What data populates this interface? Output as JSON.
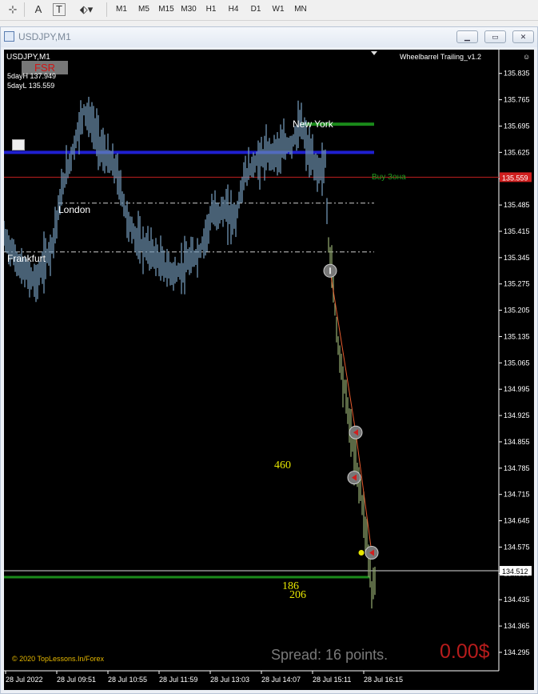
{
  "toolbar": {
    "tools": [
      {
        "name": "crosshair-icon",
        "glyph": "⊹"
      },
      {
        "name": "text-tool-icon",
        "glyph": "A"
      },
      {
        "name": "text-label-icon",
        "glyph": "T"
      },
      {
        "name": "objects-menu-icon",
        "glyph": "⬖▾"
      }
    ],
    "timeframes": [
      "M1",
      "M5",
      "M15",
      "M30",
      "H1",
      "H4",
      "D1",
      "W1",
      "MN"
    ]
  },
  "window": {
    "title": "USDJPY,M1",
    "buttons": [
      "minimize",
      "restore",
      "close"
    ]
  },
  "chart": {
    "symbol_label": "USDJPY,M1",
    "indicator_name": "Wheelbarrel Trailing_v1.2",
    "fsr_label": "FSR",
    "day_high": "5dayH 137.949",
    "day_low": "5dayL 135.559",
    "sessions": [
      "New York",
      "London",
      "Frankfurt"
    ],
    "buy_zone": "Buy Зона",
    "count_a": "460",
    "count_b": "186",
    "count_c": "206",
    "copyright": "© 2020 TopLessons.In/Forex",
    "spread": "Spread: 16 points.",
    "profit": "0.00$",
    "current_price": "134.512",
    "red_line_price": "135.559",
    "colors": {
      "background": "#000000",
      "bars": "#6f95b3",
      "support": "#1f1fd0",
      "resistance": "#c01f1f",
      "green_level": "#1a8a1a",
      "yellow_text": "#e6e600",
      "grey_text": "#7a7a7a",
      "profit_text": "#b71c1c"
    }
  },
  "chart_data": {
    "type": "candlestick",
    "y_ticks": [
      "135.835",
      "135.765",
      "135.695",
      "135.625",
      "135.555",
      "135.485",
      "135.415",
      "135.345",
      "135.275",
      "135.205",
      "135.135",
      "135.065",
      "134.995",
      "134.925",
      "134.855",
      "134.785",
      "134.715",
      "134.645",
      "134.575",
      "134.505",
      "134.435",
      "134.365",
      "134.295"
    ],
    "x_ticks": [
      "28 Jul 2022",
      "28 Jul 09:51",
      "28 Jul 10:55",
      "28 Jul 11:59",
      "28 Jul 13:03",
      "28 Jul 14:07",
      "28 Jul 15:11",
      "28 Jul 16:15"
    ],
    "ylim": [
      134.28,
      135.86
    ],
    "levels": {
      "blue_support": 135.625,
      "red_line": 135.559,
      "london_dash": 135.49,
      "frankfurt_dash": 135.36,
      "new_york_green": 135.7,
      "bottom_green": 134.495,
      "current": 134.512
    },
    "close_path": [
      [
        0,
        135.4
      ],
      [
        20,
        135.32
      ],
      [
        40,
        135.28
      ],
      [
        60,
        135.38
      ],
      [
        75,
        135.55
      ],
      [
        90,
        135.66
      ],
      [
        100,
        135.74
      ],
      [
        110,
        135.7
      ],
      [
        125,
        135.62
      ],
      [
        140,
        135.58
      ],
      [
        155,
        135.44
      ],
      [
        170,
        135.38
      ],
      [
        185,
        135.36
      ],
      [
        200,
        135.32
      ],
      [
        215,
        135.3
      ],
      [
        230,
        135.33
      ],
      [
        245,
        135.36
      ],
      [
        260,
        135.46
      ],
      [
        275,
        135.47
      ],
      [
        290,
        135.45
      ],
      [
        300,
        135.56
      ],
      [
        315,
        135.6
      ],
      [
        330,
        135.62
      ],
      [
        345,
        135.63
      ],
      [
        360,
        135.65
      ],
      [
        372,
        135.7
      ],
      [
        380,
        135.63
      ],
      [
        390,
        135.58
      ],
      [
        398,
        135.58
      ],
      [
        402,
        135.6
      ],
      [
        405,
        135.4
      ],
      [
        410,
        135.32
      ],
      [
        415,
        135.18
      ],
      [
        420,
        135.08
      ],
      [
        428,
        134.97
      ],
      [
        435,
        134.86
      ],
      [
        440,
        134.8
      ],
      [
        445,
        134.74
      ],
      [
        450,
        134.66
      ],
      [
        455,
        134.58
      ],
      [
        460,
        134.45
      ],
      [
        465,
        134.5
      ]
    ],
    "markers": [
      {
        "x": 408,
        "y": 135.31,
        "type": "entry"
      },
      {
        "x": 440,
        "y": 134.88,
        "type": "exit"
      },
      {
        "x": 438,
        "y": 134.76,
        "type": "exit"
      },
      {
        "x": 460,
        "y": 134.56,
        "type": "exit"
      }
    ]
  }
}
